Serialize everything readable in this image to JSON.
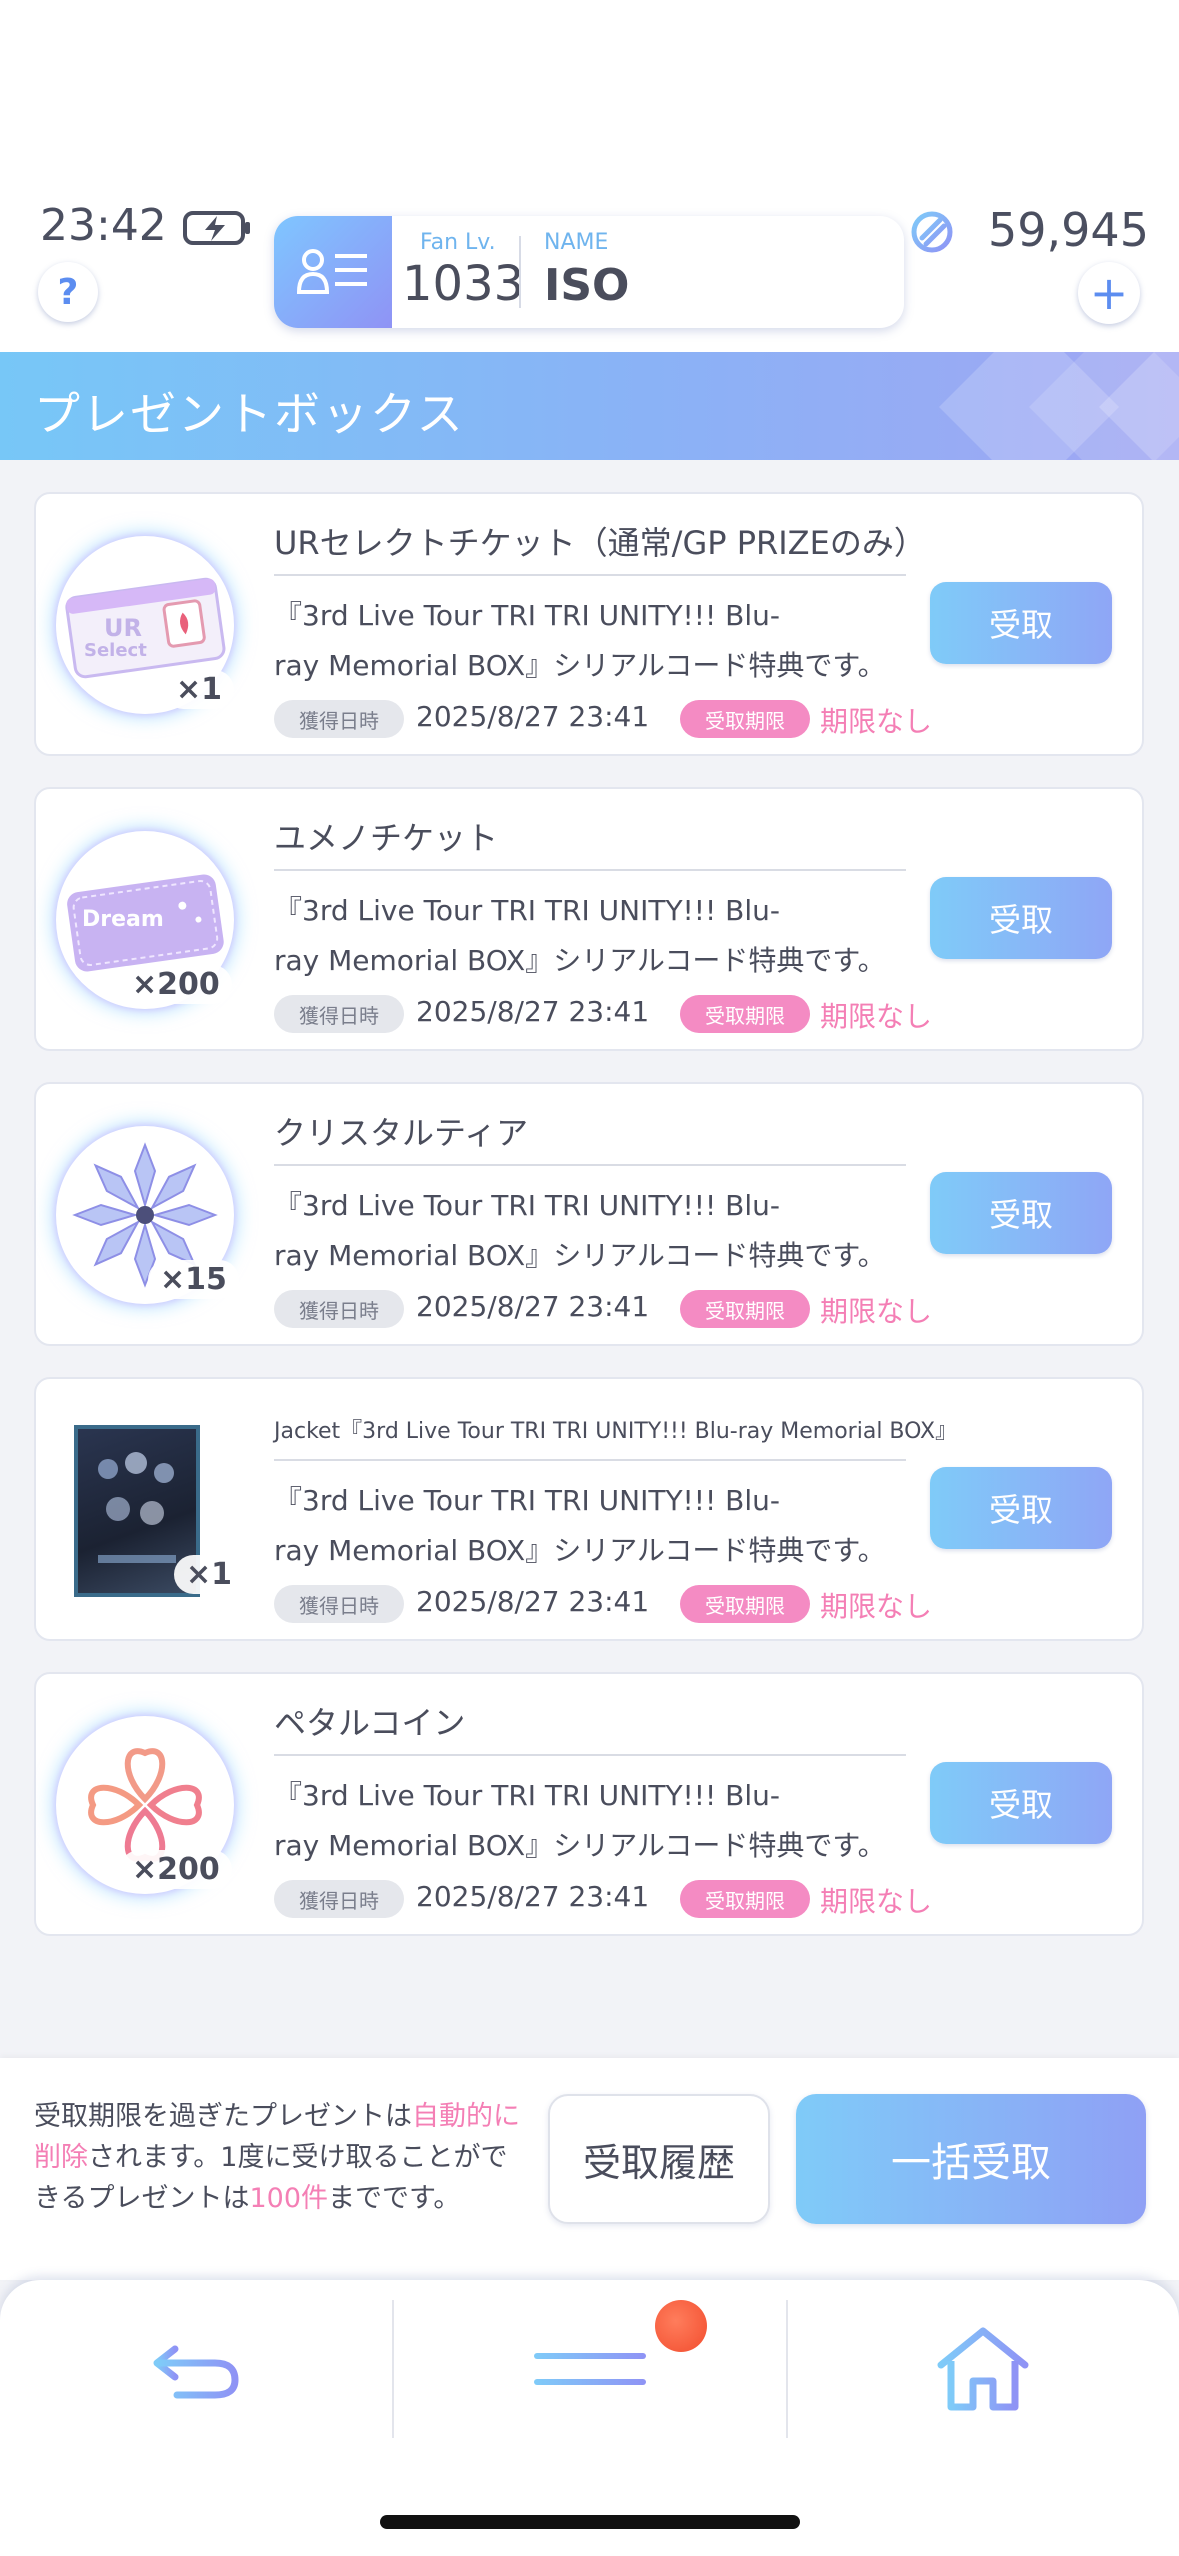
{
  "status": {
    "time": "23:42"
  },
  "profile": {
    "fan_label": "Fan Lv.",
    "fan_level": "1033",
    "name_label": "NAME",
    "name": "ISO"
  },
  "currency": {
    "amount": "59,945"
  },
  "help_label": "?",
  "plus_label": "+",
  "page_title": "プレゼントボックス",
  "labels": {
    "obtain_date": "獲得日時",
    "receive_limit": "受取期限",
    "no_limit": "期限なし",
    "receive": "受取"
  },
  "presents": [
    {
      "title": "URセレクトチケット（通常/GP PRIZEのみ）",
      "qty": "×1",
      "desc1": "『3rd Live Tour TRI TRI UNITY!!! Blu-",
      "desc2": "ray Memorial BOX』シリアルコード特典です。",
      "date": "2025/8/27 23:41",
      "thumb_text1": "UR",
      "thumb_text2": "Select"
    },
    {
      "title": "ユメノチケット",
      "qty": "×200",
      "desc1": "『3rd Live Tour TRI TRI UNITY!!! Blu-",
      "desc2": "ray Memorial BOX』シリアルコード特典です。",
      "date": "2025/8/27 23:41",
      "thumb_text1": "Dream"
    },
    {
      "title": "クリスタルティア",
      "qty": "×15",
      "desc1": "『3rd Live Tour TRI TRI UNITY!!! Blu-",
      "desc2": "ray Memorial BOX』シリアルコード特典です。",
      "date": "2025/8/27 23:41"
    },
    {
      "title": "Jacket『3rd Live Tour TRI TRI UNITY!!! Blu-ray Memorial BOX』",
      "qty": "×1",
      "desc1": "『3rd Live Tour TRI TRI UNITY!!! Blu-",
      "desc2": "ray Memorial BOX』シリアルコード特典です。",
      "date": "2025/8/27 23:41"
    },
    {
      "title": "ペタルコイン",
      "qty": "×200",
      "desc1": "『3rd Live Tour TRI TRI UNITY!!! Blu-",
      "desc2": "ray Memorial BOX』シリアルコード特典です。",
      "date": "2025/8/27 23:41"
    }
  ],
  "footer": {
    "notice_a": "受取期限を過ぎたプレゼントは",
    "notice_b": "自動的に削除",
    "notice_c": "されます。1度に受け取ることができるプレゼントは",
    "notice_d": "100件",
    "notice_e": "までです。",
    "history_label": "受取履歴",
    "bulk_label": "一括受取"
  },
  "colors": {
    "accent_blue": "#7fcbf8",
    "accent_purple": "#8fa0f5",
    "pink": "#f47fb5"
  }
}
